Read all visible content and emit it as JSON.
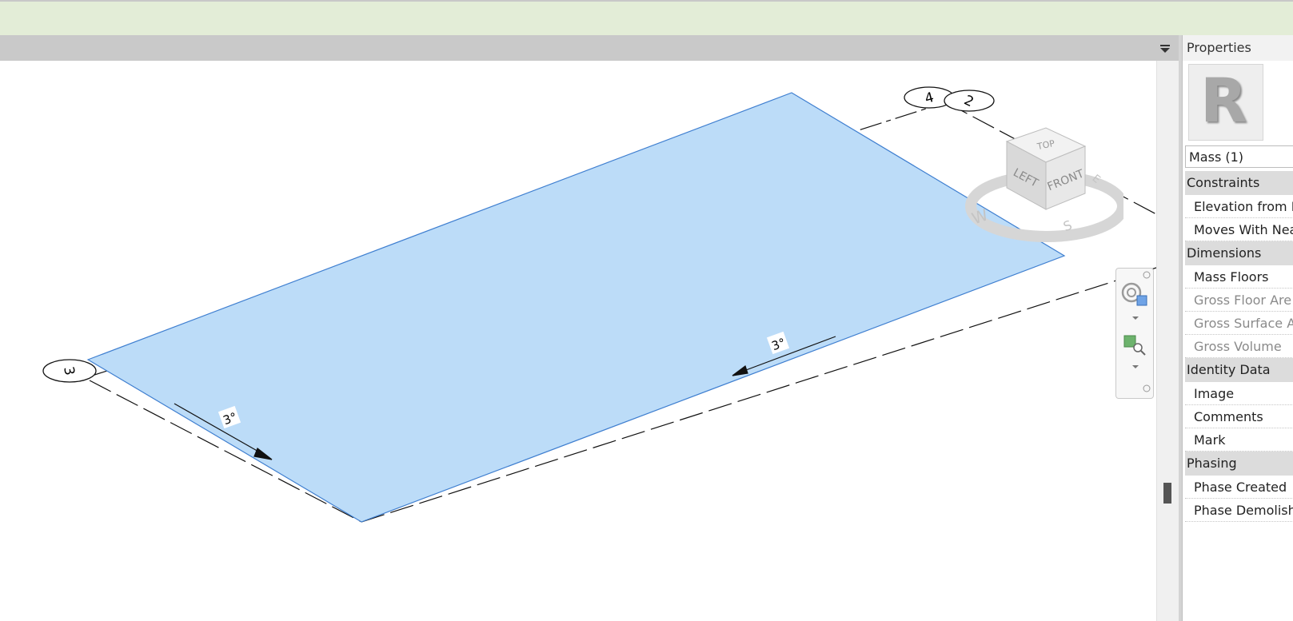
{
  "view": {
    "grid_labels": [
      "4",
      "2",
      "3"
    ],
    "slope_labels": [
      "3°",
      "3°"
    ],
    "viewcube": {
      "top": "TOP",
      "left": "LEFT",
      "front": "FRONT",
      "compass_w": "W",
      "compass_s": "S",
      "compass_e": "E"
    }
  },
  "colors": {
    "mass_fill": "#bcdcf8",
    "mass_edge": "#3f7fd0",
    "top_strip": "#e3edd7"
  },
  "properties": {
    "title": "Properties",
    "type_image_letter": "R",
    "selector": "Mass (1)",
    "groups": [
      {
        "label": "Constraints",
        "rows": [
          {
            "label": "Elevation from L",
            "disabled": false
          },
          {
            "label": "Moves With Nea",
            "disabled": false
          }
        ]
      },
      {
        "label": "Dimensions",
        "rows": [
          {
            "label": "Mass Floors",
            "disabled": false
          },
          {
            "label": "Gross Floor Are",
            "disabled": true
          },
          {
            "label": "Gross Surface A",
            "disabled": true
          },
          {
            "label": "Gross Volume",
            "disabled": true
          }
        ]
      },
      {
        "label": "Identity Data",
        "rows": [
          {
            "label": "Image",
            "disabled": false
          },
          {
            "label": "Comments",
            "disabled": false
          },
          {
            "label": "Mark",
            "disabled": false
          }
        ]
      },
      {
        "label": "Phasing",
        "rows": [
          {
            "label": "Phase Created",
            "disabled": false
          },
          {
            "label": "Phase Demolish",
            "disabled": false
          }
        ]
      }
    ]
  }
}
